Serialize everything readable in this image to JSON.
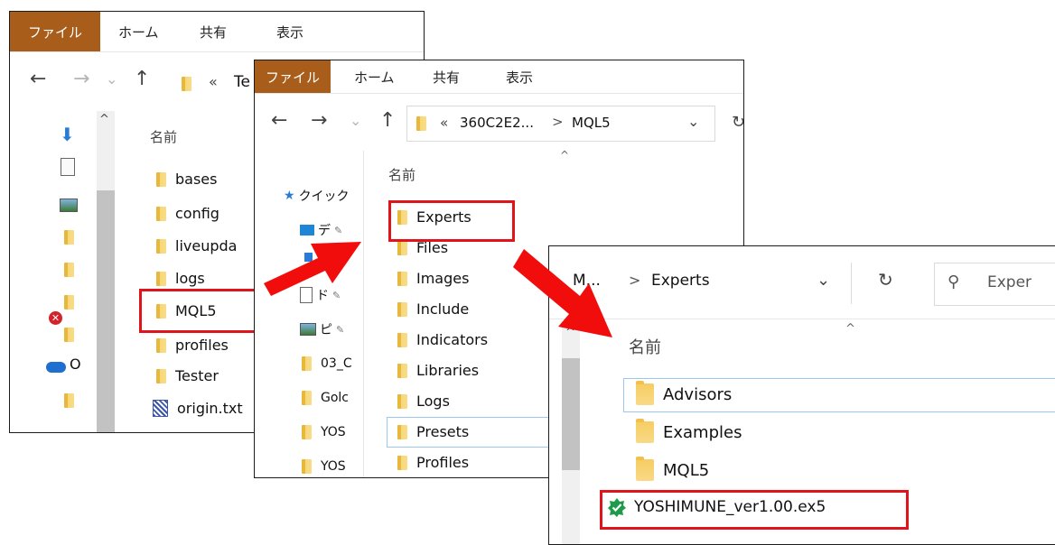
{
  "ribbon_tabs": {
    "file": "ファイル",
    "home": "ホーム",
    "share": "共有",
    "view": "表示"
  },
  "window1": {
    "address_prefix": "«",
    "address_partial": "Te",
    "column_header": "名前",
    "items": [
      "bases",
      "config",
      "liveupda",
      "logs",
      "MQL5",
      "profiles",
      "Tester",
      "origin.txt"
    ],
    "sidebar_partial": "O"
  },
  "window2": {
    "address_prefix": "«",
    "address_folder": "360C2E2...",
    "address_sep": ">",
    "address_current": "MQL5",
    "address_refresh_partial": "ひ",
    "column_header": "名前",
    "sidebar": [
      {
        "label": "クイック",
        "icon": "star-icon"
      },
      {
        "label": "デ",
        "icon": "desktop-icon"
      },
      {
        "label": "ド",
        "icon": "document-icon"
      },
      {
        "label": "ピ",
        "icon": "picture-icon"
      },
      {
        "label": "03_C",
        "icon": "folder-icon"
      },
      {
        "label": "Golc",
        "icon": "folder-icon"
      },
      {
        "label": "YOS",
        "icon": "folder-icon"
      },
      {
        "label": "YOS",
        "icon": "folder-icon"
      }
    ],
    "items": [
      "Experts",
      "Files",
      "Images",
      "Include",
      "Indicators",
      "Libraries",
      "Logs",
      "Presets",
      "Profiles"
    ]
  },
  "window3": {
    "address_prefix": "M...",
    "address_sep": ">",
    "address_current": "Experts",
    "search_placeholder": "Exper",
    "column_header": "名前",
    "items": [
      "Advisors",
      "Examples",
      "MQL5"
    ],
    "ex5_file": "YOSHIMUNE_ver1.00.ex5"
  },
  "colors": {
    "accent_file_tab": "#a85d1a",
    "highlight_red": "#e0151b",
    "arrow_red": "#f20d0d",
    "folder_yellow": "#f8d985"
  }
}
